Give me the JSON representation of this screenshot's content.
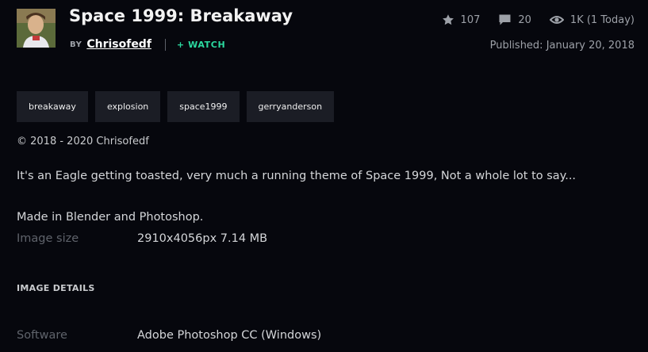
{
  "header": {
    "title": "Space 1999: Breakaway",
    "by_label": "BY",
    "author": "Chrisofedf",
    "watch_label": "+ WATCH",
    "published": "Published: January 20, 2018"
  },
  "stats": {
    "favourites": "107",
    "comments": "20",
    "views": "1K (1 Today)"
  },
  "icons": {
    "favourites": "star-icon",
    "comments": "comment-icon",
    "views": "eye-icon"
  },
  "tags": [
    "breakaway",
    "explosion",
    "space1999",
    "gerryanderson"
  ],
  "copyright": "© 2018 - 2020 Chrisofedf",
  "description": {
    "line1": "It's an Eagle getting toasted, very much a running theme of Space 1999, Not a whole lot to say...",
    "line2": "Made in Blender and Photoshop."
  },
  "image_size": {
    "label": "Image size",
    "value": "2910x4056px 7.14 MB"
  },
  "image_details": {
    "heading": "IMAGE DETAILS",
    "software_label": "Software",
    "software_value": "Adobe Photoshop CC (Windows)"
  },
  "colors": {
    "background": "#06070d",
    "accent_watch": "#2bd99f",
    "tag_background": "#1b1d25"
  }
}
